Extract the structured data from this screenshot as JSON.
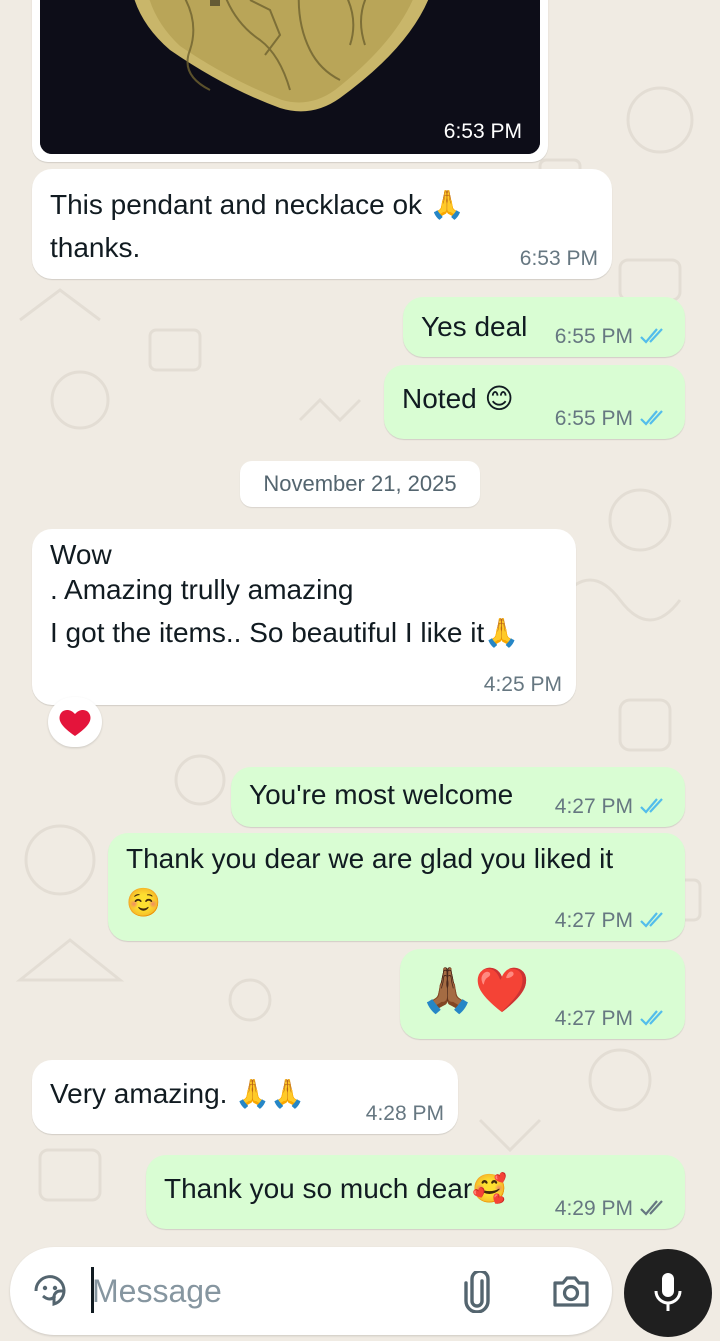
{
  "chat": {
    "messages": [
      {
        "id": "m0",
        "direction": "in",
        "type": "image",
        "time": "6:53 PM"
      },
      {
        "id": "m1",
        "direction": "in",
        "line1": "This pendant and necklace ok 🙏",
        "line2": "thanks.",
        "time": "6:53 PM"
      },
      {
        "id": "m2",
        "direction": "out",
        "text": "Yes deal",
        "time": "6:55 PM",
        "status": "read"
      },
      {
        "id": "m3",
        "direction": "out",
        "text": "Noted 😊",
        "time": "6:55 PM",
        "status": "read"
      },
      {
        "id": "m4",
        "direction": "in",
        "line1": "Wow",
        "line2": ". Amazing trully amazing",
        "line3": "I got the items.. So beautiful I like it🙏",
        "time": "4:25 PM",
        "reaction": "❤️"
      },
      {
        "id": "m5",
        "direction": "out",
        "text": "You're most welcome",
        "time": "4:27 PM",
        "status": "read"
      },
      {
        "id": "m6",
        "direction": "out",
        "line1": "Thank you dear we are glad you liked it",
        "line2": "☺️",
        "time": "4:27 PM",
        "status": "read"
      },
      {
        "id": "m7",
        "direction": "out",
        "text": "🙏🏾❤️",
        "time": "4:27 PM",
        "status": "read"
      },
      {
        "id": "m8",
        "direction": "in",
        "text": "Very amazing. 🙏🙏",
        "time": "4:28 PM"
      },
      {
        "id": "m9",
        "direction": "out",
        "text": "Thank you so much dear🥰",
        "time": "4:29 PM",
        "status": "delivered"
      }
    ],
    "date_separator": "November 21, 2025"
  },
  "composer": {
    "placeholder": "Message",
    "value": "",
    "icons": [
      "sticker-icon",
      "attach-icon",
      "camera-icon",
      "mic-icon"
    ]
  },
  "colors": {
    "background": "#f0ebe3",
    "incoming_bubble": "#ffffff",
    "outgoing_bubble": "#d9fdd3",
    "read_tick": "#53bdeb",
    "delivered_tick": "#667781",
    "mic_button": "#1f1f1f"
  }
}
